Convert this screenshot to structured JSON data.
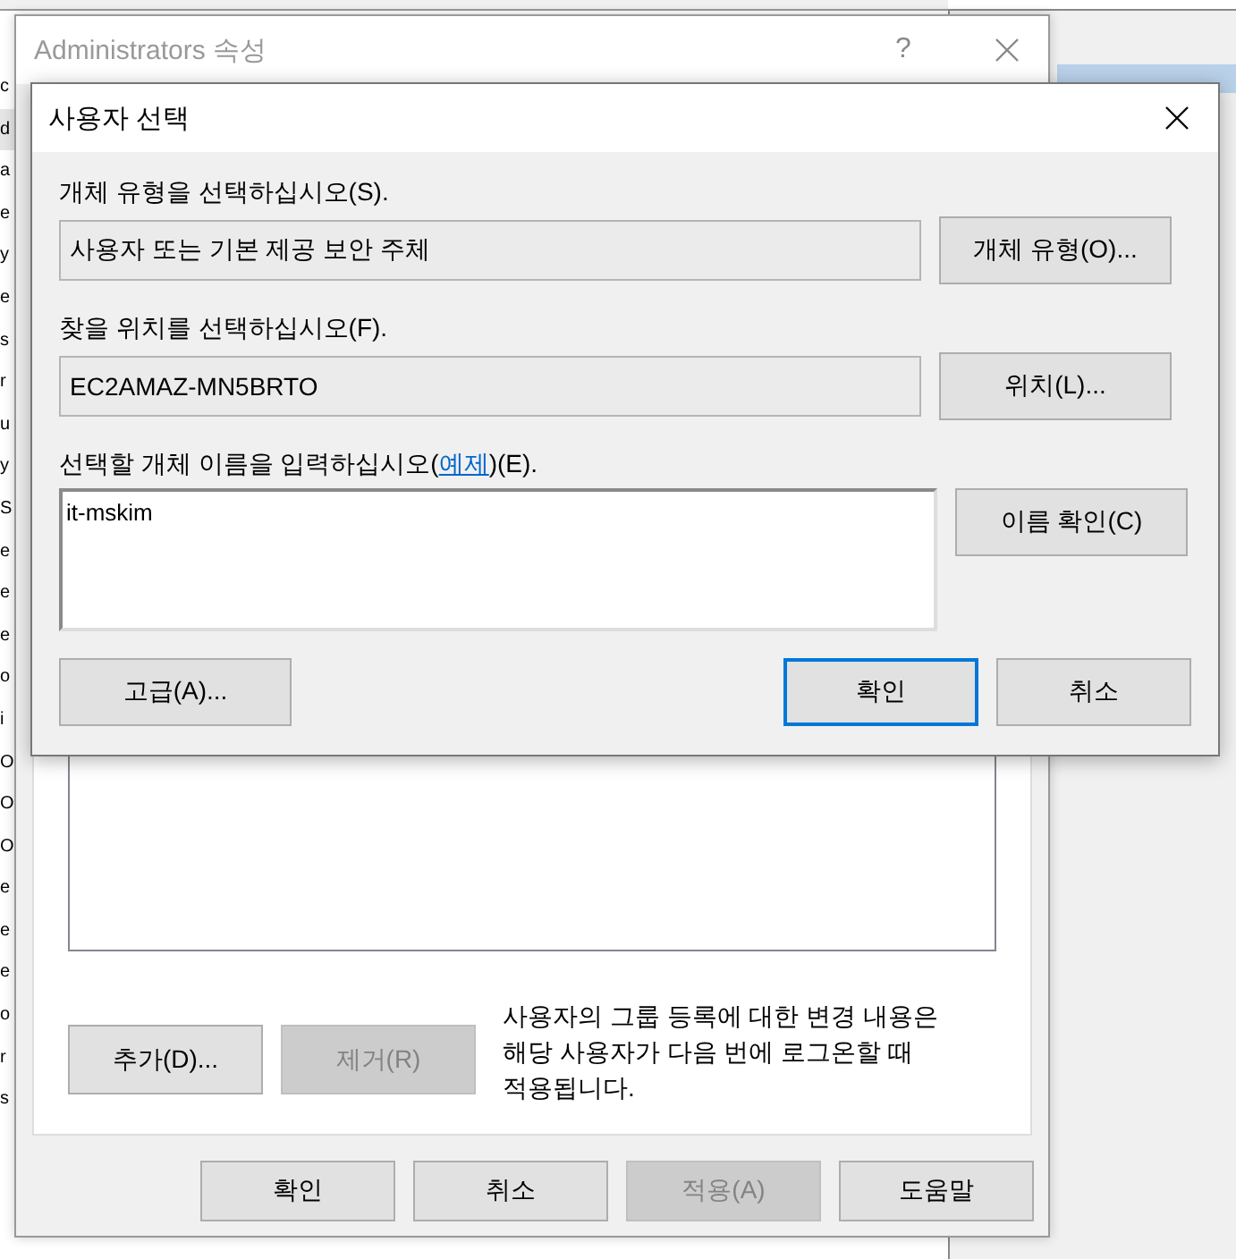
{
  "background_list": [
    {
      "text": "c",
      "selected": false
    },
    {
      "text": "d",
      "selected": true
    },
    {
      "text": "a",
      "selected": false
    },
    {
      "text": "e",
      "selected": false
    },
    {
      "text": "y",
      "selected": false
    },
    {
      "text": "e",
      "selected": false
    },
    {
      "text": "s",
      "selected": false
    },
    {
      "text": "r",
      "selected": false
    },
    {
      "text": "u",
      "selected": false
    },
    {
      "text": "y",
      "selected": false
    },
    {
      "text": "S",
      "selected": false
    },
    {
      "text": "e",
      "selected": false
    },
    {
      "text": "e",
      "selected": false
    },
    {
      "text": "e",
      "selected": false
    },
    {
      "text": "o",
      "selected": false
    },
    {
      "text": "i",
      "selected": false
    },
    {
      "text": "O",
      "selected": false
    },
    {
      "text": "O",
      "selected": false
    },
    {
      "text": "O",
      "selected": false
    },
    {
      "text": "e",
      "selected": false
    },
    {
      "text": "e",
      "selected": false
    },
    {
      "text": "e",
      "selected": false
    },
    {
      "text": "o",
      "selected": false
    },
    {
      "text": "r",
      "selected": false
    },
    {
      "text": "s",
      "selected": false
    }
  ],
  "properties_window": {
    "title": "Administrators 속성",
    "help": "?",
    "member_buttons": [
      {
        "label": "추가(D)...",
        "disabled": false
      },
      {
        "label": "제거(R)",
        "disabled": true
      }
    ],
    "note": "사용자의 그룹 등록에 대한 변경 내용은 해당 사용자가 다음 번에 로그온할 때 적용됩니다.",
    "footer_buttons": [
      {
        "label": "확인",
        "disabled": false
      },
      {
        "label": "취소",
        "disabled": false
      },
      {
        "label": "적용(A)",
        "disabled": true
      },
      {
        "label": "도움말",
        "disabled": false
      }
    ]
  },
  "select_dialog": {
    "title": "사용자 선택",
    "object_type": {
      "label": "개체 유형을 선택하십시오(S).",
      "value": "사용자 또는 기본 제공 보안 주체",
      "button": "개체 유형(O)..."
    },
    "location": {
      "label": "찾을 위치를 선택하십시오(F).",
      "value": "EC2AMAZ-MN5BRTO",
      "button": "위치(L)..."
    },
    "names": {
      "label_before": "선택할 개체 이름을 입력하십시오(",
      "link": "예제",
      "label_after": ")(E).",
      "value": "it-mskim",
      "button": "이름 확인(C)"
    },
    "buttons": [
      {
        "label": "고급(A)...",
        "default": false
      },
      {
        "label": "확인",
        "default": true
      },
      {
        "label": "취소",
        "default": false
      }
    ]
  }
}
